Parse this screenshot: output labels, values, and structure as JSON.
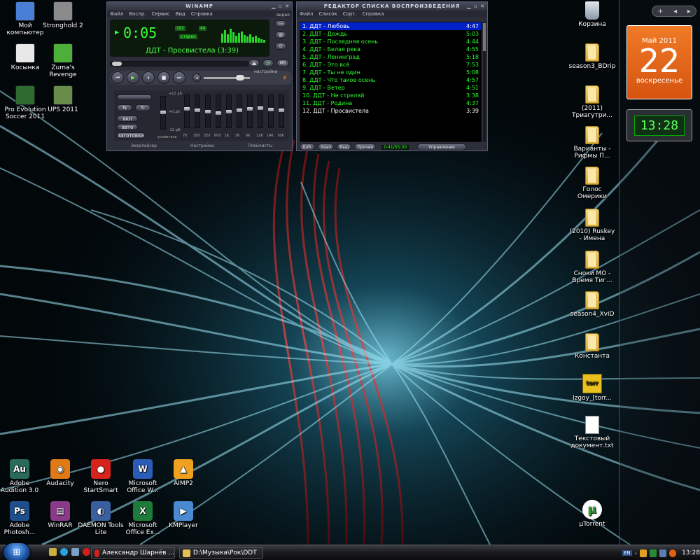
{
  "desktop": {
    "left_icons": [
      {
        "label": "Мой компьютер",
        "icon": "my-computer-icon",
        "color": "#4a7fd6"
      },
      {
        "label": "Stronghold 2",
        "icon": "stronghold-icon",
        "color": "#8a8a8a"
      },
      {
        "label": "Косынка",
        "icon": "solitaire-icon",
        "color": "#e8e8e8"
      },
      {
        "label": "Zuma's Revenge",
        "icon": "zuma-icon",
        "color": "#4caf3a"
      },
      {
        "label": "Pro Evolution Soccer 2011",
        "icon": "pes-icon",
        "color": "#2e6b2e"
      },
      {
        "label": "UPS 2011",
        "icon": "ups-icon",
        "color": "#6a8c4a"
      }
    ],
    "bottom_icons": [
      {
        "label": "Adobe Audition 3.0",
        "icon": "audition-icon",
        "glyph": "Au",
        "color": "#2a6a5a"
      },
      {
        "label": "Audacity",
        "icon": "audacity-icon",
        "glyph": "◉",
        "color": "#e07a16"
      },
      {
        "label": "Nero StartSmart",
        "icon": "nero-icon",
        "glyph": "●",
        "color": "#d8231d"
      },
      {
        "label": "Microsoft Office W...",
        "icon": "word-icon",
        "glyph": "W",
        "color": "#2b5cb8"
      },
      {
        "label": "AIMP2",
        "icon": "aimp-icon",
        "glyph": "▲",
        "color": "#f0a020"
      },
      {
        "label": "Adobe Photosh...",
        "icon": "photoshop-icon",
        "glyph": "Ps",
        "color": "#1f4f8a"
      },
      {
        "label": "WinRAR",
        "icon": "winrar-icon",
        "glyph": "▤",
        "color": "#8b3a8a"
      },
      {
        "label": "DAEMON Tools Lite",
        "icon": "daemon-tools-icon",
        "glyph": "◐",
        "color": "#3a5fa0"
      },
      {
        "label": "Microsoft Office Ex...",
        "icon": "excel-icon",
        "glyph": "X",
        "color": "#1e7a3a"
      },
      {
        "label": "KMPlayer",
        "icon": "kmplayer-icon",
        "glyph": "▶",
        "color": "#4a8ad0"
      }
    ],
    "right_icons": [
      {
        "label": "Корзина",
        "icon": "recycle-bin-icon",
        "kind": "bin"
      },
      {
        "label": "season3_BDrip",
        "icon": "folder-icon",
        "kind": "folder"
      },
      {
        "label": "(2011) Триагутри...",
        "icon": "folder-icon",
        "kind": "folder"
      },
      {
        "label": "Варианты - Рифмы П...",
        "icon": "folder-icon",
        "kind": "folder"
      },
      {
        "label": "Голос Омерики",
        "icon": "folder-icon",
        "kind": "folder"
      },
      {
        "label": "(2010) Ruskey - Имена",
        "icon": "folder-icon",
        "kind": "folder"
      },
      {
        "label": "Сноки МО - Время Тиг...",
        "icon": "folder-icon",
        "kind": "folder"
      },
      {
        "label": "season4_XviD",
        "icon": "folder-icon",
        "kind": "folder"
      },
      {
        "label": "Константа",
        "icon": "folder-icon",
        "kind": "folder"
      },
      {
        "label": "Izgoy_[torr...",
        "icon": "torrent-file-icon",
        "kind": "file"
      },
      {
        "label": "Текстовый документ.txt",
        "icon": "text-file-icon",
        "kind": "txt"
      },
      {
        "label": "µTorrent",
        "icon": "utorrent-icon",
        "kind": "utorrent"
      }
    ]
  },
  "winamp": {
    "title": "WINAMP",
    "menu": [
      "Файл",
      "Воспр.",
      "Сервис",
      "Вид",
      "Справка"
    ],
    "time": "0:05",
    "kbps": "192",
    "khz": "44",
    "stereo": "стерео",
    "track_title": "ДДТ - Просвистела (3:39)",
    "video_label": "видео",
    "settings_label": "настройки",
    "eq": {
      "on_label": "вкл",
      "auto_label": "авто",
      "presets_label": "заготовки",
      "db_top": "+12 дБ",
      "db_mid": "+0 дБ",
      "db_bottom": "-12 дБ",
      "preamp_label": "усилитель",
      "bands": [
        "70",
        "180",
        "320",
        "600",
        "1K",
        "3K",
        "6K",
        "12K",
        "14K",
        "16K"
      ],
      "levels": [
        0.6,
        0.55,
        0.5,
        0.45,
        0.5,
        0.55,
        0.6,
        0.62,
        0.58,
        0.55
      ]
    },
    "tabs": [
      "Эквалайзер",
      "Настройки",
      "Плейлисты"
    ]
  },
  "playlist": {
    "title": "РЕДАКТОР СПИСКА ВОСПРОИЗВЕДЕНИЯ",
    "menu": [
      "Файл",
      "Список",
      "Сорт.",
      "Справка"
    ],
    "tracks": [
      {
        "name": "1. ДДТ - Любовь",
        "time": "4:47",
        "state": "sel"
      },
      {
        "name": "2. ДДТ - Дождь",
        "time": "5:03",
        "state": ""
      },
      {
        "name": "3. ДДТ - Последняя осень",
        "time": "4:44",
        "state": ""
      },
      {
        "name": "4. ДДТ - Белая река",
        "time": "4:55",
        "state": ""
      },
      {
        "name": "5. ДДТ - Ленинград",
        "time": "5:18",
        "state": ""
      },
      {
        "name": "6. ДДТ - Это всё",
        "time": "7:53",
        "state": ""
      },
      {
        "name": "7. ДДТ - Ты не один",
        "time": "5:08",
        "state": ""
      },
      {
        "name": "8. ДДТ - Что такое осень",
        "time": "4:57",
        "state": ""
      },
      {
        "name": "9. ДДТ - Ветер",
        "time": "4:51",
        "state": ""
      },
      {
        "name": "10. ДДТ - Не стреляй",
        "time": "3:38",
        "state": ""
      },
      {
        "name": "11. ДДТ - Родина",
        "time": "4:37",
        "state": ""
      },
      {
        "name": "12. ДДТ - Просвистела",
        "time": "3:39",
        "state": "cur"
      }
    ],
    "buttons": [
      "Доб.",
      "Удал",
      "Выд",
      "Прочее"
    ],
    "counter": "0:41/55:30",
    "manage_label": "Управление"
  },
  "gadgets": {
    "calendar_month": "Май 2011",
    "calendar_day": "22",
    "calendar_weekday": "воскресенье",
    "clock": "13:28"
  },
  "taskbar": {
    "tasks": [
      {
        "label": "Александр Шарнёв ...",
        "icon": "opera-icon"
      },
      {
        "label": "D:\\Музыка\\Рок\\DDT",
        "icon": "folder-icon"
      }
    ],
    "lang": "EN",
    "time": "13:28"
  }
}
